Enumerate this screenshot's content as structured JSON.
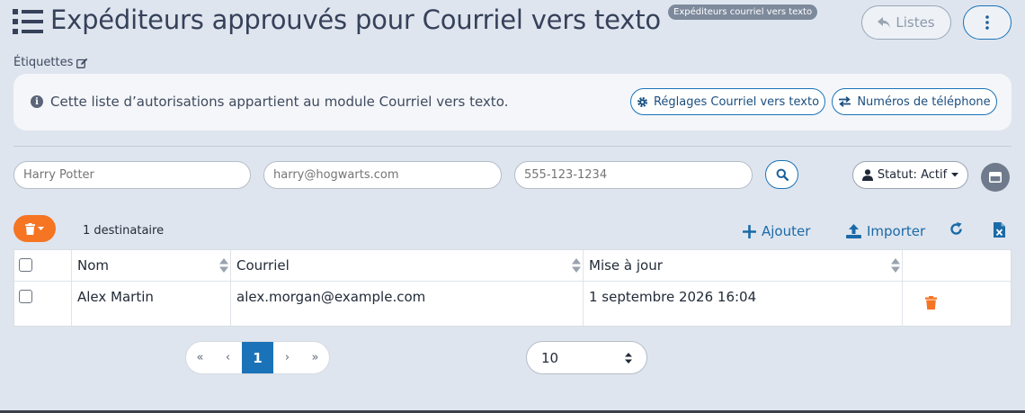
{
  "header": {
    "title": "Expéditeurs approuvés pour Courriel vers texto",
    "badge": "Expéditeurs courriel vers texto",
    "lists_button": "Listes",
    "labels_link": "Étiquettes"
  },
  "info": {
    "text": "Cette liste d’autorisations appartient au module Courriel vers texto.",
    "settings_button": "Réglages Courriel vers texto",
    "phones_button": "Numéros de téléphone"
  },
  "filters": {
    "name_placeholder": "Harry Potter",
    "email_placeholder": "harry@hogwarts.com",
    "phone_placeholder": "555-123-1234",
    "status_label": "Statut: Actif"
  },
  "toolbar": {
    "recipient_count": "1 destinataire",
    "add_label": "Ajouter",
    "import_label": "Importer"
  },
  "table": {
    "columns": [
      "Nom",
      "Courriel",
      "Mise à jour"
    ],
    "rows": [
      {
        "name": "Alex Martin",
        "email": "alex.morgan@example.com",
        "updated": "1 septembre 2026 16:04"
      }
    ]
  },
  "pagination": {
    "first": "«",
    "prev": "‹",
    "current": "1",
    "next": "›",
    "last": "»",
    "page_size": "10"
  },
  "colors": {
    "accent": "#1a73b8",
    "danger": "#f57523",
    "background": "#dfe5ee"
  }
}
